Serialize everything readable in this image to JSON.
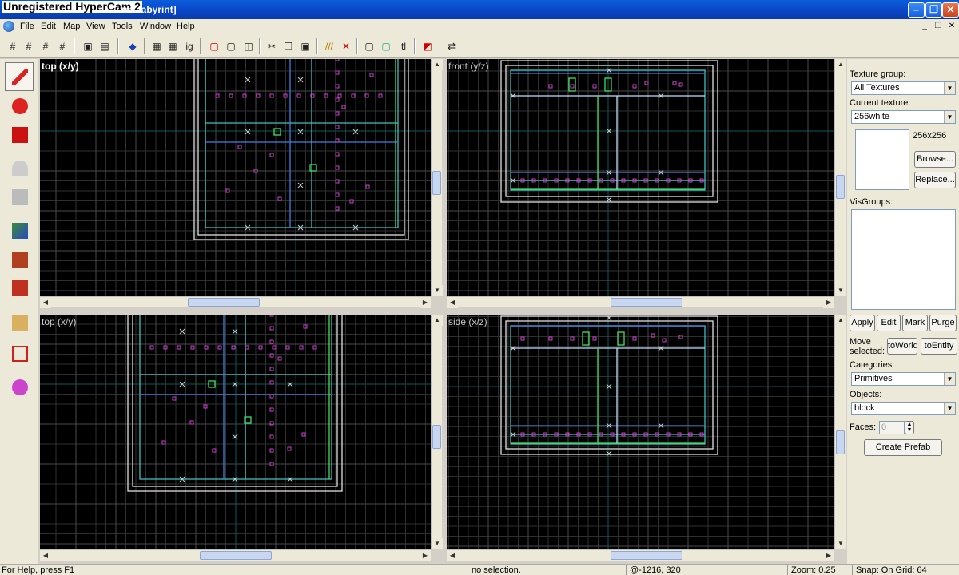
{
  "watermark": "Unregistered HyperCam 2",
  "window": {
    "title": "zm_labyrint]"
  },
  "menu": [
    "File",
    "Edit",
    "Map",
    "View",
    "Tools",
    "Window",
    "Help"
  ],
  "viewports": {
    "top_left": "top (x/y)",
    "top_right": "front (y/z)",
    "bottom_left": "top (x/y)",
    "bottom_right": "side (x/z)"
  },
  "panel": {
    "texture_group_label": "Texture group:",
    "texture_group_value": "All Textures",
    "current_texture_label": "Current texture:",
    "current_texture_value": "256white",
    "texture_size": "256x256",
    "browse": "Browse...",
    "replace": "Replace...",
    "visgroups_label": "VisGroups:",
    "apply": "Apply",
    "edit": "Edit",
    "mark": "Mark",
    "purge": "Purge",
    "move_selected": "Move selected:",
    "to_world": "toWorld",
    "to_entity": "toEntity",
    "categories_label": "Categories:",
    "categories_value": "Primitives",
    "objects_label": "Objects:",
    "objects_value": "block",
    "faces_label": "Faces:",
    "faces_value": "0",
    "create_prefab": "Create Prefab"
  },
  "status": {
    "help": "For Help, press F1",
    "selection": "no selection.",
    "coords": "@-1216, 320",
    "zoom": "Zoom: 0.25",
    "snap": "Snap: On Grid: 64"
  }
}
